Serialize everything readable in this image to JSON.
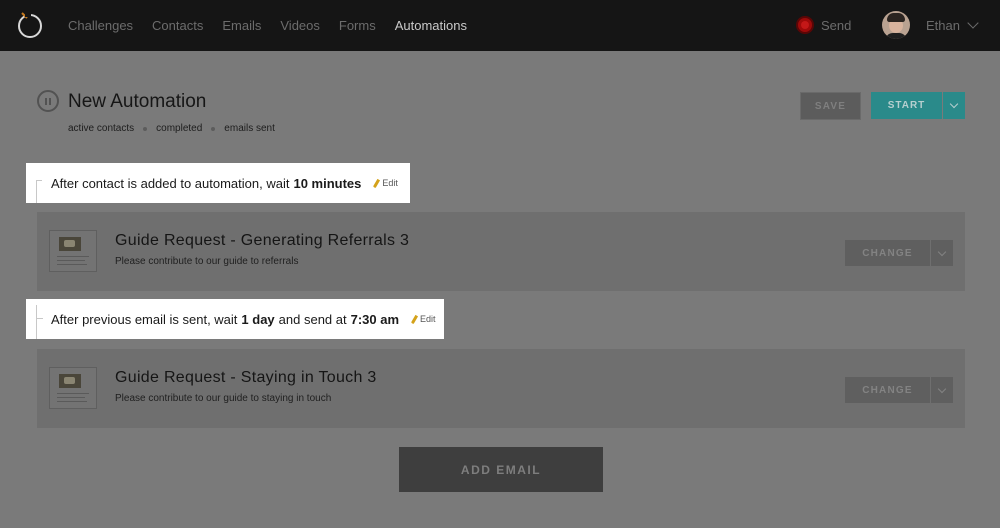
{
  "nav": {
    "items": [
      {
        "label": "Challenges",
        "active": false
      },
      {
        "label": "Contacts",
        "active": false
      },
      {
        "label": "Emails",
        "active": false
      },
      {
        "label": "Videos",
        "active": false
      },
      {
        "label": "Forms",
        "active": false
      },
      {
        "label": "Automations",
        "active": true
      }
    ],
    "send_label": "Send",
    "user_name": "Ethan"
  },
  "header": {
    "title": "New Automation",
    "stats": [
      "active contacts",
      "completed",
      "emails sent"
    ],
    "save_label": "SAVE",
    "start_label": "START"
  },
  "steps": [
    {
      "type": "wait",
      "prefix": "After contact is added to automation, wait",
      "duration": "10 minutes",
      "edit_label": "Edit"
    },
    {
      "type": "email",
      "title": "Guide Request - Generating Referrals 3",
      "subtitle": "Please contribute to our guide to referrals",
      "change_label": "CHANGE"
    },
    {
      "type": "wait",
      "prefix": "After previous email is sent, wait",
      "duration": "1 day",
      "middle": "and send at",
      "time": "7:30 am",
      "edit_label": "Edit"
    },
    {
      "type": "email",
      "title": "Guide Request - Staying in Touch 3",
      "subtitle": "Please contribute to our guide to staying in touch",
      "change_label": "CHANGE"
    }
  ],
  "add_email_label": "ADD EMAIL",
  "colors": {
    "topbar": "#151515",
    "overlay_background": "#7a7a7a",
    "start_button": "#2a8a8a",
    "send_indicator": "#c41818",
    "edit_pencil": "#d4a21a"
  }
}
